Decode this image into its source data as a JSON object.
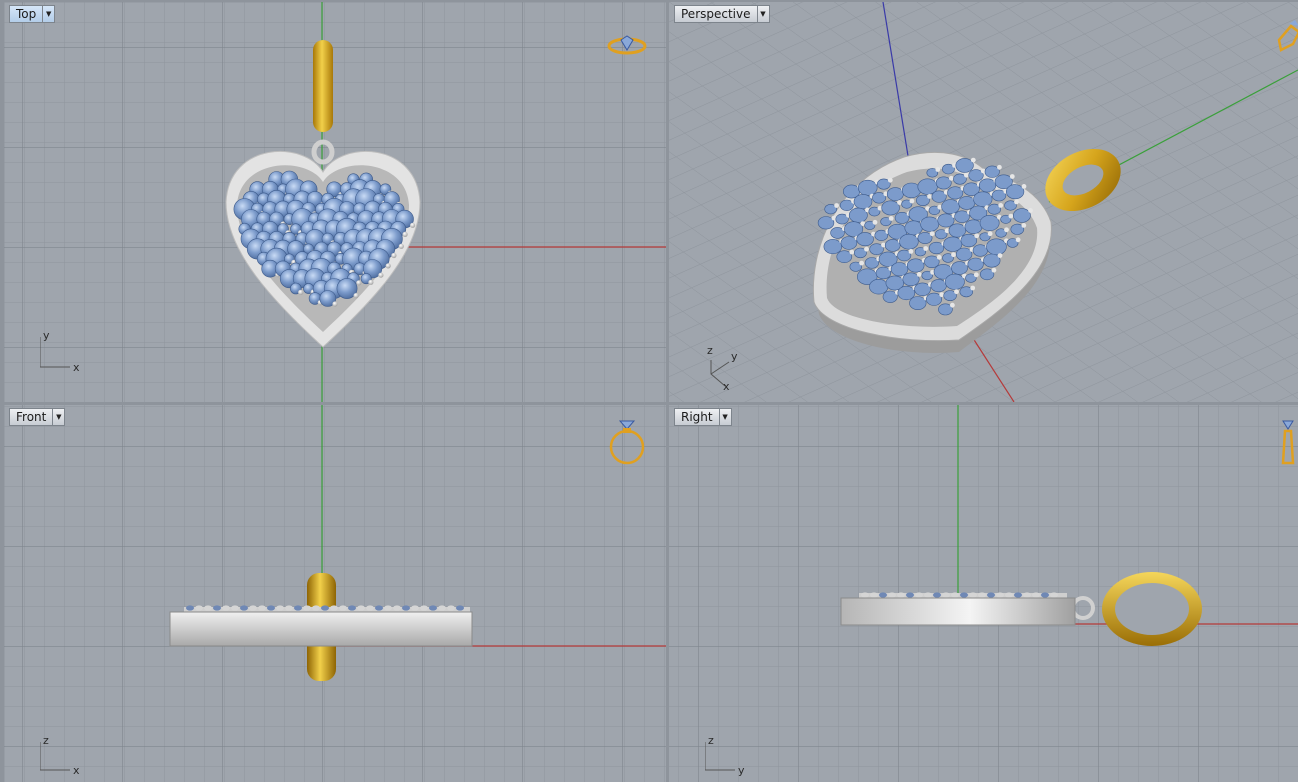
{
  "viewports": [
    {
      "id": "top",
      "title": "Top",
      "active": true,
      "axes": [
        "y",
        "x"
      ]
    },
    {
      "id": "perspective",
      "title": "Perspective",
      "active": false,
      "axes": [
        "z",
        "y",
        "x"
      ]
    },
    {
      "id": "front",
      "title": "Front",
      "active": false,
      "axes": [
        "z",
        "x"
      ]
    },
    {
      "id": "right",
      "title": "Right",
      "active": false,
      "axes": [
        "z",
        "y"
      ]
    }
  ],
  "icons": {
    "view_cube": "ring-gizmo-icon",
    "dropdown": "chevron-down-icon"
  },
  "colors": {
    "grid_bg": "#9fa5ad",
    "grid_line": "#8f959d",
    "grid_major": "#7f858d",
    "x_axis": "#b53a3a",
    "y_axis": "#3aa03a",
    "z_axis": "#3a3aa8",
    "gold": "#d6a51c",
    "metal": "#d8d8d8",
    "gem": "#7c9bcb"
  }
}
